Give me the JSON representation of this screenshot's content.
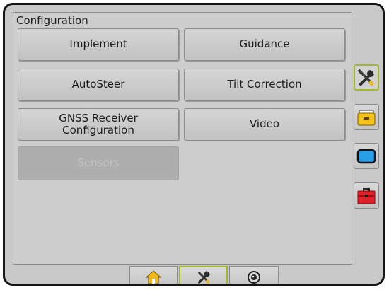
{
  "panel": {
    "title": "Configuration"
  },
  "buttons": {
    "implement": "Implement",
    "guidance": "Guidance",
    "autosteer": "AutoSteer",
    "tilt_correction": "Tilt Correction",
    "gnss_line1": "GNSS Receiver",
    "gnss_line2": "Configuration",
    "video": "Video",
    "sensors": "Sensors"
  },
  "side_tabs": [
    {
      "icon": "tools-icon",
      "active": true
    },
    {
      "icon": "console-icon",
      "active": false
    },
    {
      "icon": "display-icon",
      "active": false
    },
    {
      "icon": "toolbox-icon",
      "active": false
    }
  ],
  "bottom_tabs": [
    {
      "icon": "home-icon",
      "active": false
    },
    {
      "icon": "tools-icon",
      "active": true
    },
    {
      "icon": "camera-icon",
      "active": false
    }
  ],
  "colors": {
    "active_outline": "#a2b82c",
    "folder_yellow": "#f5c21b",
    "toolbox_red": "#e0202a",
    "display_blue": "#2a9ee8"
  }
}
